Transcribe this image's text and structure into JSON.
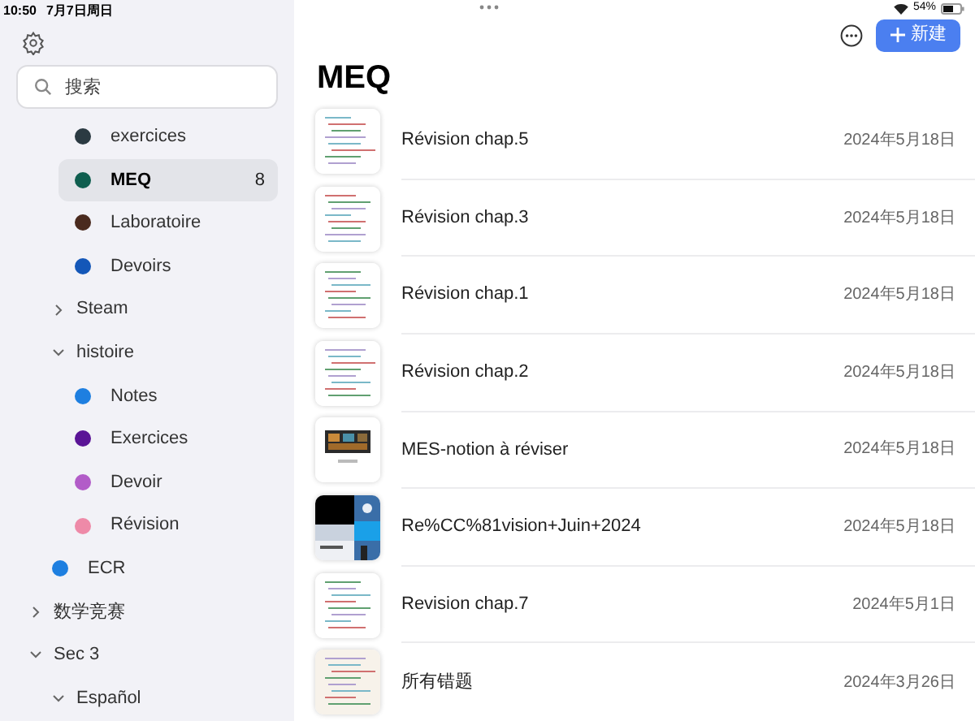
{
  "status_bar": {
    "time": "10:50",
    "date": "7月7日周日",
    "battery": "54%"
  },
  "sidebar": {
    "search": {
      "placeholder": "搜索"
    },
    "tree": [
      {
        "children": [
          {
            "children": [
              {
                "kind": "notebook",
                "label": "exercices",
                "color": "#2b3a42",
                "selected": false
              },
              {
                "kind": "notebook",
                "label": "MEQ",
                "color": "#0f5e4f",
                "selected": true,
                "count": "8"
              },
              {
                "kind": "notebook",
                "label": "Laboratoire",
                "color": "#4a2a1e",
                "selected": false
              },
              {
                "kind": "notebook",
                "label": "Devoirs",
                "color": "#1457b8",
                "selected": false
              }
            ]
          },
          {
            "kind": "folder",
            "label": "Steam",
            "expanded": false,
            "selected": false
          },
          {
            "kind": "folder",
            "label": "histoire",
            "expanded": true,
            "selected": false,
            "children": [
              {
                "kind": "notebook",
                "label": "Notes",
                "color": "#1e7fe0",
                "selected": false
              },
              {
                "kind": "notebook",
                "label": "Exercices",
                "color": "#5a1496",
                "selected": false
              },
              {
                "kind": "notebook",
                "label": "Devoir",
                "color": "#b25cc8",
                "selected": false
              },
              {
                "kind": "notebook",
                "label": "Révision",
                "color": "#ee8aa8",
                "selected": false
              }
            ]
          },
          {
            "kind": "notebook",
            "label": "ECR",
            "color": "#1e7fe0",
            "selected": false
          }
        ]
      },
      {
        "kind": "folder",
        "label": "数学竞赛",
        "expanded": false,
        "selected": false
      },
      {
        "kind": "folder",
        "label": "Sec 3",
        "expanded": true,
        "selected": false,
        "children": [
          {
            "kind": "folder",
            "label": "Español",
            "expanded": true,
            "selected": false
          }
        ]
      }
    ]
  },
  "toolbar": {
    "new_button": "新建"
  },
  "title": "MEQ",
  "notes": [
    {
      "title": "Révision chap.5",
      "date": "2024年5月18日"
    },
    {
      "title": "Révision chap.3",
      "date": "2024年5月18日"
    },
    {
      "title": "Révision chap.1",
      "date": "2024年5月18日"
    },
    {
      "title": "Révision chap.2",
      "date": "2024年5月18日"
    },
    {
      "title": "MES-notion à réviser",
      "date": "2024年5月18日"
    },
    {
      "title": "Re%CC%81vision+Juin+2024",
      "date": "2024年5月18日"
    },
    {
      "title": "Revision chap.7",
      "date": "2024年5月1日"
    },
    {
      "title": "所有错题",
      "date": "2024年3月26日"
    }
  ]
}
